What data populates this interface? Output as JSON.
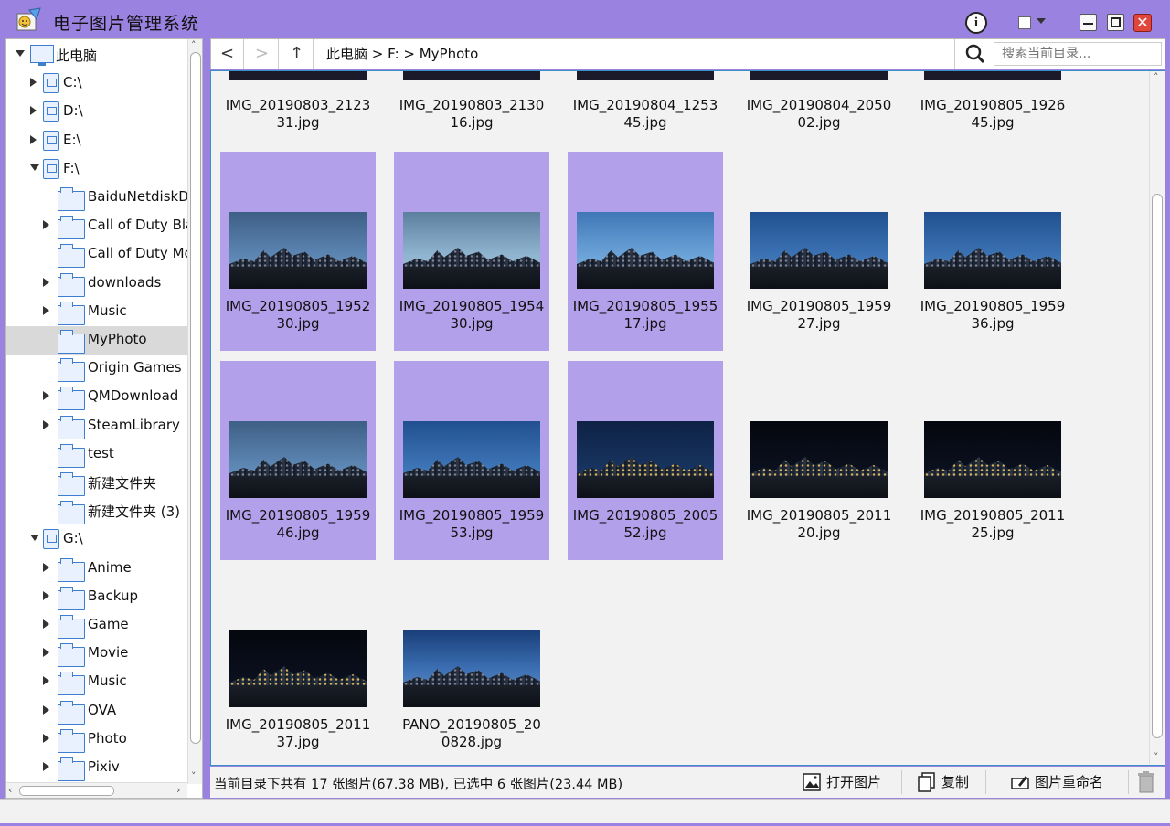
{
  "window": {
    "title": "电子图片管理系统",
    "accent": "#9a82e0",
    "selection_color": "#b3a0ea"
  },
  "titlebar": {
    "info_icon": "info-icon",
    "theme_icon": "square-icon",
    "minimize_icon": "minimize-icon",
    "maximize_icon": "maximize-icon",
    "close_icon": "close-icon"
  },
  "tree": {
    "root": "此电脑",
    "items": [
      {
        "label": "C:\\",
        "icon": "drive-icon"
      },
      {
        "label": "D:\\",
        "icon": "drive-icon"
      },
      {
        "label": "E:\\",
        "icon": "drive-icon"
      },
      {
        "label": "F:\\",
        "icon": "drive-icon"
      },
      {
        "label": "BaiduNetdiskD",
        "icon": "folder-icon"
      },
      {
        "label": "Call of Duty Bla",
        "icon": "folder-icon"
      },
      {
        "label": "Call of Duty Mo",
        "icon": "folder-icon"
      },
      {
        "label": "downloads",
        "icon": "folder-icon"
      },
      {
        "label": "Music",
        "icon": "folder-icon"
      },
      {
        "label": "MyPhoto",
        "icon": "folder-icon",
        "selected": true
      },
      {
        "label": "Origin Games",
        "icon": "folder-icon"
      },
      {
        "label": "QMDownload",
        "icon": "folder-icon"
      },
      {
        "label": "SteamLibrary",
        "icon": "folder-icon"
      },
      {
        "label": "test",
        "icon": "folder-icon"
      },
      {
        "label": "新建文件夹",
        "icon": "folder-icon"
      },
      {
        "label": "新建文件夹 (3)",
        "icon": "folder-icon"
      },
      {
        "label": "G:\\",
        "icon": "drive-icon"
      },
      {
        "label": "Anime",
        "icon": "folder-icon"
      },
      {
        "label": "Backup",
        "icon": "folder-icon"
      },
      {
        "label": "Game",
        "icon": "folder-icon"
      },
      {
        "label": "Movie",
        "icon": "folder-icon"
      },
      {
        "label": "Music",
        "icon": "folder-icon"
      },
      {
        "label": "OVA",
        "icon": "folder-icon"
      },
      {
        "label": "Photo",
        "icon": "folder-icon"
      },
      {
        "label": "Pixiv",
        "icon": "folder-icon"
      }
    ]
  },
  "nav": {
    "back": "<",
    "forward": ">",
    "up": "↑",
    "path": "此电脑 > F: > MyPhoto",
    "search_placeholder": "搜索当前目录..."
  },
  "grid": {
    "top_row": [
      {
        "line1": "IMG_20190803_2123",
        "line2": "31.jpg"
      },
      {
        "line1": "IMG_20190803_2130",
        "line2": "16.jpg"
      },
      {
        "line1": "IMG_20190804_1253",
        "line2": "45.jpg"
      },
      {
        "line1": "IMG_20190804_2050",
        "line2": "02.jpg"
      },
      {
        "line1": "IMG_20190805_1926",
        "line2": "45.jpg"
      }
    ],
    "tiles": [
      {
        "line1": "IMG_20190805_1952",
        "line2": "30.jpg",
        "selected": true
      },
      {
        "line1": "IMG_20190805_1954",
        "line2": "30.jpg",
        "selected": true
      },
      {
        "line1": "IMG_20190805_1955",
        "line2": "17.jpg",
        "selected": true
      },
      {
        "line1": "IMG_20190805_1959",
        "line2": "27.jpg",
        "selected": false
      },
      {
        "line1": "IMG_20190805_1959",
        "line2": "36.jpg",
        "selected": false
      },
      {
        "line1": "IMG_20190805_1959",
        "line2": "46.jpg",
        "selected": true
      },
      {
        "line1": "IMG_20190805_1959",
        "line2": "53.jpg",
        "selected": true
      },
      {
        "line1": "IMG_20190805_2005",
        "line2": "52.jpg",
        "selected": true
      },
      {
        "line1": "IMG_20190805_2011",
        "line2": "20.jpg",
        "selected": false
      },
      {
        "line1": "IMG_20190805_2011",
        "line2": "25.jpg",
        "selected": false
      },
      {
        "line1": "IMG_20190805_2011",
        "line2": "37.jpg",
        "selected": false
      },
      {
        "line1": "PANO_20190805_20",
        "line2": "0828.jpg",
        "selected": false
      }
    ]
  },
  "status": {
    "text": "当前目录下共有 17 张图片(67.38 MB), 已选中 6 张图片(23.44 MB)",
    "open_label": "打开图片",
    "copy_label": "复制",
    "rename_label": "图片重命名",
    "delete_icon": "trash-icon"
  }
}
